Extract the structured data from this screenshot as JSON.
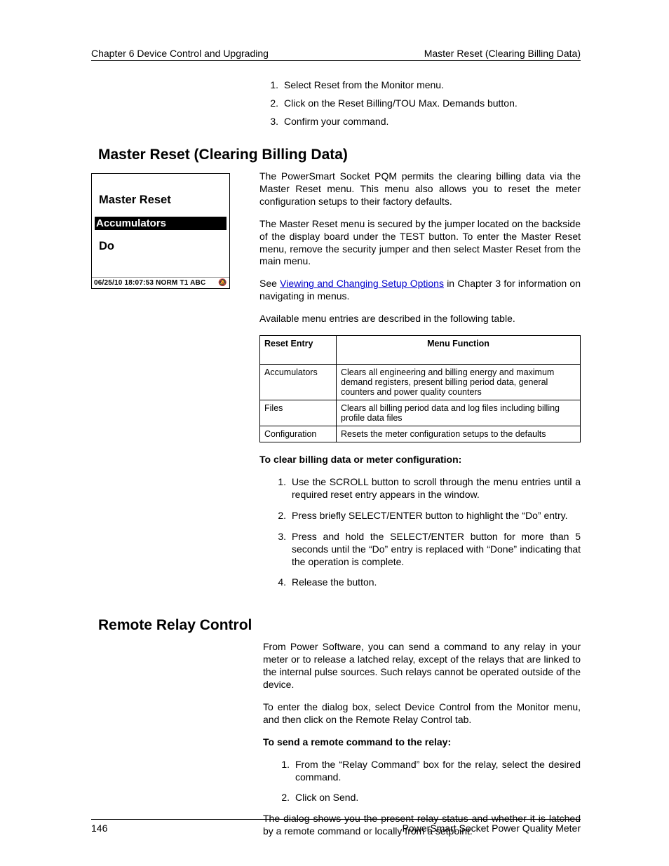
{
  "header": {
    "left": "Chapter 6 Device Control and Upgrading",
    "right": "Master Reset (Clearing Billing Data)"
  },
  "top_steps": [
    "Select Reset from the Monitor menu.",
    "Click on the Reset Billing/TOU Max. Demands button.",
    "Confirm your command."
  ],
  "section1": {
    "title": "Master Reset (Clearing Billing Data)",
    "device_screen": {
      "title": "Master Reset",
      "selected": "Accumulators",
      "action": "Do",
      "status_left": "06/25/10 18:07:53  NORM T1  ABC",
      "status_icon": "bell-cancel"
    },
    "para1": "The PowerSmart Socket PQM permits the clearing billing data via the Master Reset menu. This menu also allows you to reset the meter configuration setups to their factory defaults.",
    "para2": "The Master Reset menu is secured by the jumper located on the backside of the display board under the TEST button. To enter the Master Reset menu, remove the security jumper and then select Master Reset from the main menu.",
    "para3_pre": "See ",
    "para3_link": "Viewing and Changing Setup Options",
    "para3_post": " in Chapter 3 for information on navigating in menus.",
    "para4": "Available menu entries are described in the following table.",
    "table": {
      "head": [
        "Reset Entry",
        "Menu Function"
      ],
      "rows": [
        [
          "Accumulators",
          "Clears all engineering and billing energy and maximum demand registers, present billing period data, general counters and power quality counters"
        ],
        [
          "Files",
          "Clears all billing period data and log files including billing profile data files"
        ],
        [
          "Configuration",
          "Resets the meter configuration setups to the defaults"
        ]
      ]
    },
    "lead": "To clear billing data or meter configuration:",
    "steps": [
      "Use the SCROLL button to scroll through the menu entries until a required reset entry appears in the window.",
      "Press briefly SELECT/ENTER button to highlight the “Do” entry.",
      "Press and hold the SELECT/ENTER button for more than 5 seconds until the “Do” entry is replaced with “Done” indicating that the operation is complete.",
      "Release the button."
    ]
  },
  "section2": {
    "title": "Remote Relay Control",
    "para1": "From Power Software, you can send a command to any relay in your meter or to release a latched relay, except of the relays that are linked to the internal pulse sources. Such relays cannot be operated outside of the device.",
    "para2": "To enter the dialog box, select Device Control from the Monitor menu, and then click on the Remote Relay Control tab.",
    "lead": "To send a remote command to the relay:",
    "steps": [
      "From the “Relay Command” box for the relay, select the desired command.",
      "Click on Send."
    ],
    "para3": "The dialog shows you the present relay status and whether it is latched by a remote command or locally from a setpoint."
  },
  "footer": {
    "page": "146",
    "title": "PowerSmart Socket Power Quality Meter"
  }
}
